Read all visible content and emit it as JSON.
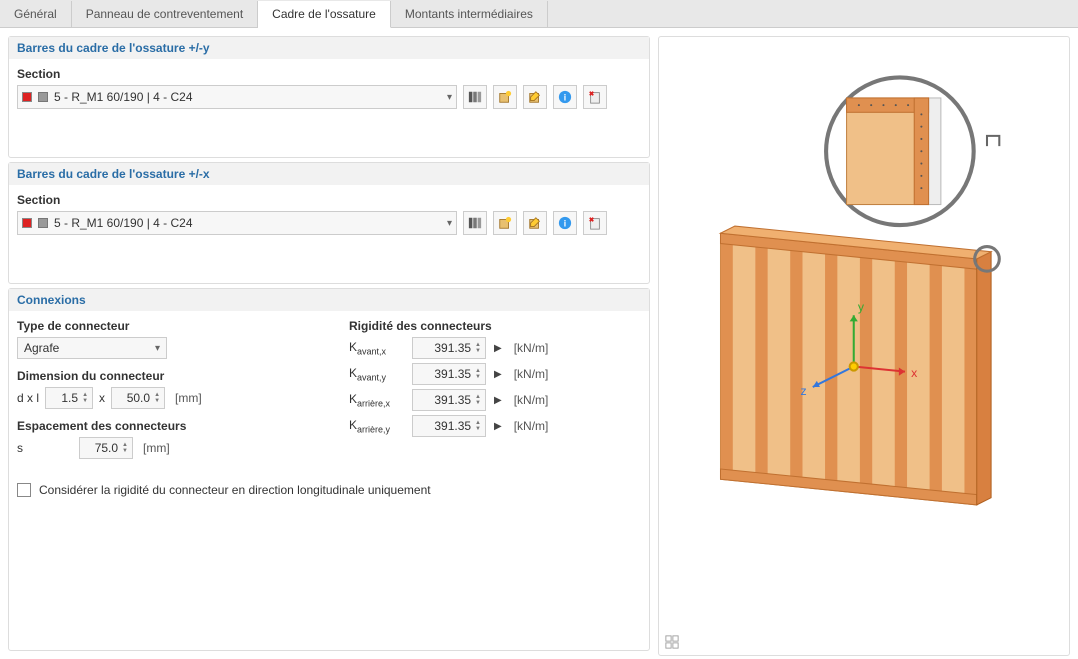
{
  "tabs": [
    {
      "label": "Général",
      "active": false
    },
    {
      "label": "Panneau de contreventement",
      "active": false
    },
    {
      "label": "Cadre de l'ossature",
      "active": true
    },
    {
      "label": "Montants intermédiaires",
      "active": false
    }
  ],
  "panel_y": {
    "title": "Barres du cadre de l'ossature +/-y",
    "section_label": "Section",
    "section_value": "5 - R_M1 60/190 | 4 - C24"
  },
  "panel_x": {
    "title": "Barres du cadre de l'ossature +/-x",
    "section_label": "Section",
    "section_value": "5 - R_M1 60/190 | 4 - C24"
  },
  "connections": {
    "title": "Connexions",
    "connector_type_label": "Type de connecteur",
    "connector_type_value": "Agrafe",
    "connector_dim_label": "Dimension du connecteur",
    "dim_prefix": "d x l",
    "dim_d": "1.5",
    "dim_sep": "x",
    "dim_l": "50.0",
    "dim_unit": "[mm]",
    "spacing_label": "Espacement des connecteurs",
    "spacing_var": "s",
    "spacing_value": "75.0",
    "spacing_unit": "[mm]",
    "rigidity_label": "Rigidité des connecteurs",
    "rows": [
      {
        "key": "Kavant,x",
        "value": "391.35",
        "unit": "[kN/m]"
      },
      {
        "key": "Kavant,y",
        "value": "391.35",
        "unit": "[kN/m]"
      },
      {
        "key": "Karrière,x",
        "value": "391.35",
        "unit": "[kN/m]"
      },
      {
        "key": "Karrière,y",
        "value": "391.35",
        "unit": "[kN/m]"
      }
    ],
    "checkbox_label": "Considérer la rigidité du connecteur en direction longitudinale uniquement"
  },
  "icons": {
    "book": "book-icon",
    "new": "new-icon",
    "edit": "edit-icon",
    "info": "info-icon",
    "tool": "tool-icon"
  },
  "axes": {
    "x": "x",
    "y": "y",
    "z": "z"
  }
}
